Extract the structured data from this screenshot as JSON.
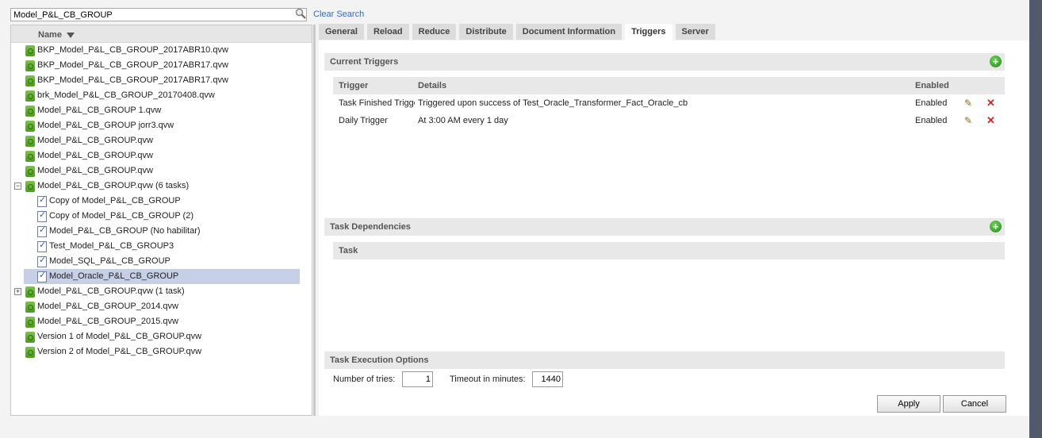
{
  "search": {
    "value": "Model_P&L_CB_GROUP",
    "clear_label": "Clear Search"
  },
  "tree": {
    "header": "Name",
    "items": [
      {
        "label": "BKP_Model_P&L_CB_GROUP_2017ABR10.qvw",
        "type": "doc"
      },
      {
        "label": "BKP_Model_P&L_CB_GROUP_2017ABR17.qvw",
        "type": "doc"
      },
      {
        "label": "BKP_Model_P&L_CB_GROUP_2017ABR17.qvw",
        "type": "doc"
      },
      {
        "label": "brk_Model_P&L_CB_GROUP_20170408.qvw",
        "type": "doc"
      },
      {
        "label": "Model_P&L_CB_GROUP 1.qvw",
        "type": "doc"
      },
      {
        "label": "Model_P&L_CB_GROUP jorr3.qvw",
        "type": "doc"
      },
      {
        "label": "Model_P&L_CB_GROUP.qvw",
        "type": "doc"
      },
      {
        "label": "Model_P&L_CB_GROUP.qvw",
        "type": "doc"
      },
      {
        "label": "Model_P&L_CB_GROUP.qvw",
        "type": "doc"
      },
      {
        "label": "Model_P&L_CB_GROUP.qvw (6 tasks)",
        "type": "doc",
        "expander": "−"
      },
      {
        "label": "Copy of Model_P&L_CB_GROUP",
        "type": "task"
      },
      {
        "label": "Copy of Model_P&L_CB_GROUP (2)",
        "type": "task"
      },
      {
        "label": "Model_P&L_CB_GROUP (No habilitar)",
        "type": "task"
      },
      {
        "label": "Test_Model_P&L_CB_GROUP3",
        "type": "task"
      },
      {
        "label": "Model_SQL_P&L_CB_GROUP",
        "type": "task"
      },
      {
        "label": "Model_Oracle_P&L_CB_GROUP",
        "type": "task",
        "selected": true
      },
      {
        "label": "Model_P&L_CB_GROUP.qvw (1 task)",
        "type": "doc",
        "expander": "+"
      },
      {
        "label": "Model_P&L_CB_GROUP_2014.qvw",
        "type": "doc"
      },
      {
        "label": "Model_P&L_CB_GROUP_2015.qvw",
        "type": "doc"
      },
      {
        "label": "Version 1 of Model_P&L_CB_GROUP.qvw",
        "type": "doc"
      },
      {
        "label": "Version 2 of Model_P&L_CB_GROUP.qvw",
        "type": "doc"
      }
    ]
  },
  "tabs": [
    "General",
    "Reload",
    "Reduce",
    "Distribute",
    "Document Information",
    "Triggers",
    "Server"
  ],
  "active_tab": "Triggers",
  "current_triggers": {
    "title": "Current Triggers",
    "columns": [
      "Trigger",
      "Details",
      "Enabled"
    ],
    "rows": [
      {
        "trigger": "Task Finished Trigge",
        "details": "Triggered upon success of Test_Oracle_Transformer_Fact_Oracle_cb",
        "enabled": "Enabled"
      },
      {
        "trigger": "Daily Trigger",
        "details": "At 3:00 AM every 1 day",
        "enabled": "Enabled"
      }
    ]
  },
  "task_dependencies": {
    "title": "Task Dependencies",
    "column": "Task"
  },
  "execution": {
    "title": "Task Execution Options",
    "tries_label": "Number of tries:",
    "tries_value": "1",
    "timeout_label": "Timeout in minutes:",
    "timeout_value": "1440"
  },
  "buttons": {
    "apply": "Apply",
    "cancel": "Cancel"
  },
  "colors": {
    "link": "#2a6fc9",
    "selected_row": "#c5d0e6",
    "add": "#1d8a12",
    "delete": "#e02020"
  }
}
